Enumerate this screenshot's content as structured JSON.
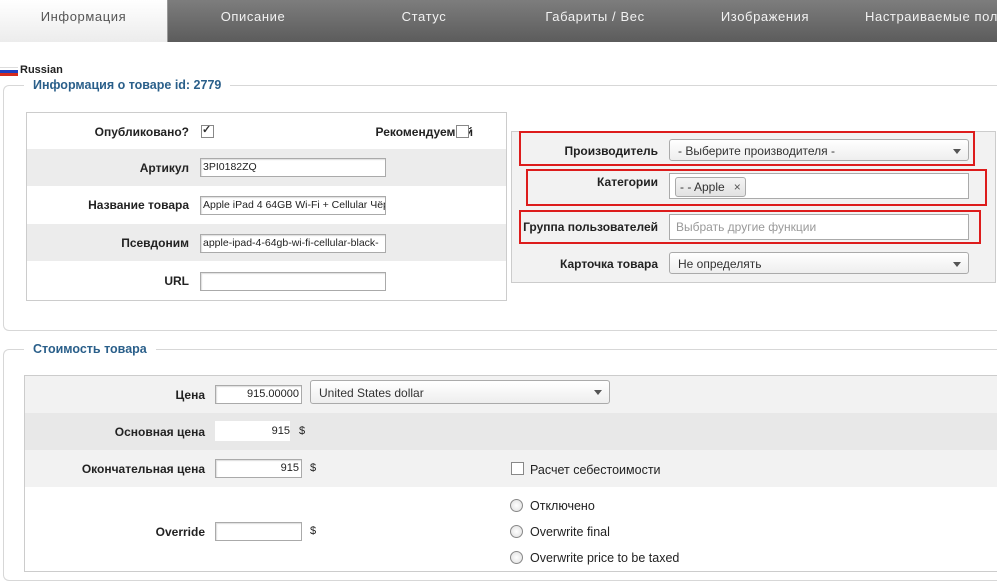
{
  "tabs": [
    {
      "label": "Информация"
    },
    {
      "label": "Описание"
    },
    {
      "label": "Статус"
    },
    {
      "label": "Габариты / Вес"
    },
    {
      "label": "Изображения"
    },
    {
      "label": "Настраиваемые пол"
    }
  ],
  "language": {
    "label": "Russian"
  },
  "info": {
    "legend": "Информация о товаре id: 2779",
    "published_label": "Опубликовано?",
    "published_checked": true,
    "featured_label": "Рекомендуемый",
    "featured_checked": false,
    "sku_label": "Артикул",
    "sku_value": "3PI0182ZQ",
    "name_label": "Название товара",
    "name_value": "Apple iPad 4 64GB Wi-Fi + Cellular Чёр",
    "alias_label": "Псевдоним",
    "alias_value": "apple-ipad-4-64gb-wi-fi-cellular-black-",
    "url_label": "URL",
    "url_value": "",
    "manufacturer_label": "Производитель",
    "manufacturer_value": "- Выберите производителя -",
    "categories_label": "Категории",
    "category_token": "- - Apple",
    "token_remove": "×",
    "usergroup_label": "Группа пользователей",
    "usergroup_placeholder": "Выбрать другие функции",
    "card_label": "Карточка товара",
    "card_value": "Не определять"
  },
  "price": {
    "legend": "Стоимость товара",
    "price_label": "Цена",
    "price_value": "915.00000",
    "currency_value": "United States dollar",
    "base_label": "Основная цена",
    "base_value": "915",
    "base_currency": "$",
    "final_label": "Окончательная цена",
    "final_value": "915",
    "final_currency": "$",
    "cost_calc_label": "Расчет себестоимости",
    "override_label": "Override",
    "override_value": "",
    "override_currency": "$",
    "override_options": [
      "Отключено",
      "Overwrite final",
      "Overwrite price to be taxed"
    ]
  },
  "colors": {
    "accent": "#2a5f8a",
    "highlight": "#dd1c1c",
    "tabbar": "#6b6b6b"
  }
}
